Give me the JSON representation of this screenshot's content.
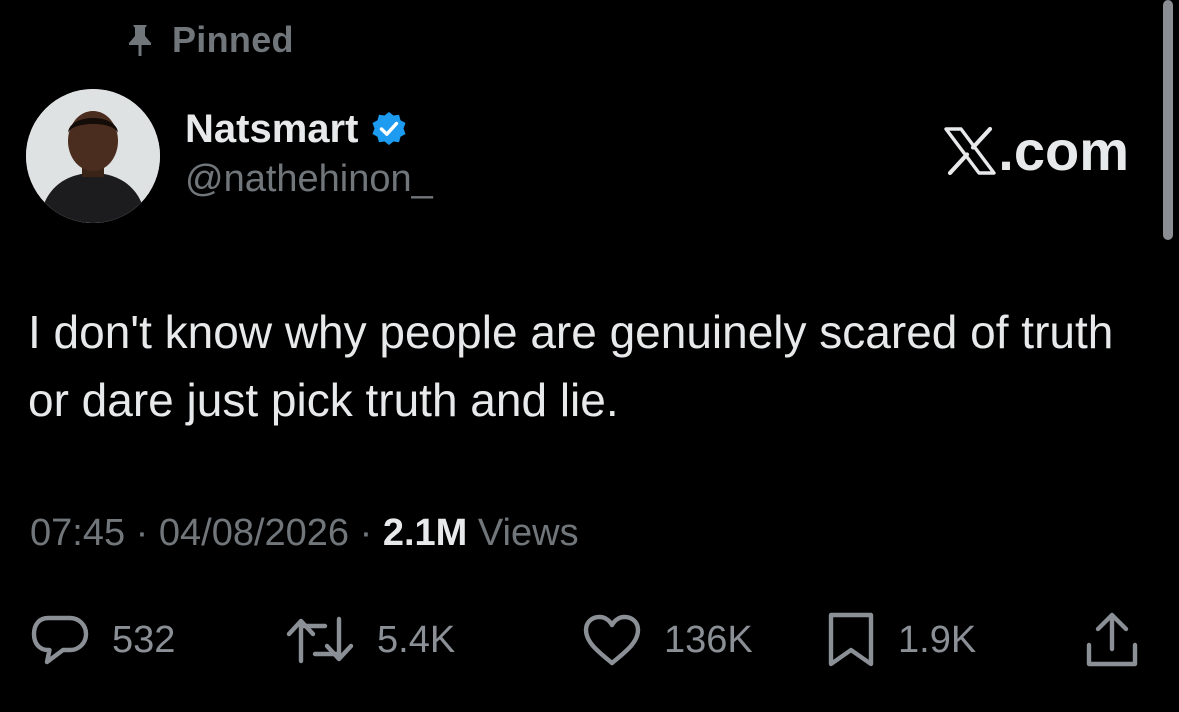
{
  "pinned": {
    "icon": "pin-icon",
    "label": "Pinned"
  },
  "author": {
    "avatar_icon": "avatar-portrait",
    "display_name": "Natsmart",
    "verified_icon": "verified-badge-icon",
    "handle": "@nathehinon_"
  },
  "brand": {
    "logo_icon": "x-logo-icon",
    "suffix": ".com"
  },
  "tweet": {
    "text": "I don't know why people are genuinely scared of truth or dare just pick truth and lie."
  },
  "meta": {
    "time": "07:45",
    "separator_1": " · ",
    "date": "04/08/2026",
    "separator_2": " · ",
    "views_count": "2.1M",
    "views_label": " Views"
  },
  "actions": {
    "reply": {
      "icon": "reply-icon",
      "count": "532"
    },
    "retweet": {
      "icon": "retweet-icon",
      "count": "5.4K"
    },
    "like": {
      "icon": "heart-icon",
      "count": "136K"
    },
    "bookmark": {
      "icon": "bookmark-icon",
      "count": "1.9K"
    },
    "share": {
      "icon": "share-icon"
    }
  },
  "colors": {
    "background": "#000000",
    "primary_text": "#e7e9ea",
    "secondary_text": "#71767b",
    "verified_blue": "#1d9bf0"
  }
}
